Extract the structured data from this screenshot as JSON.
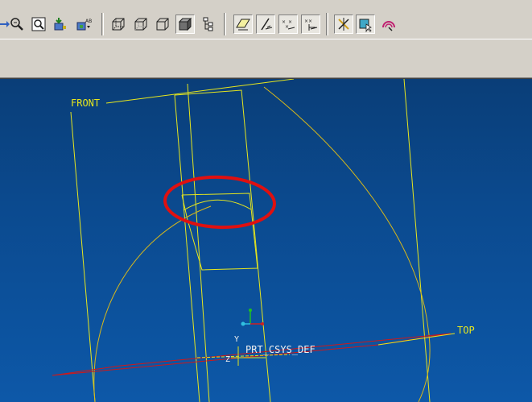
{
  "toolbar": {
    "buttons": [
      {
        "name": "orient-icon"
      },
      {
        "name": "zoom-in-icon"
      },
      {
        "name": "zoom-to-fit-icon"
      },
      {
        "name": "repaint-icon"
      },
      {
        "name": "saved-views-icon"
      },
      {
        "name": "wireframe-icon"
      },
      {
        "name": "hidden-line-icon"
      },
      {
        "name": "no-hidden-icon"
      },
      {
        "name": "shading-icon"
      },
      {
        "name": "model-tree-icon"
      },
      {
        "name": "datum-planes-icon"
      },
      {
        "name": "datum-axes-icon"
      },
      {
        "name": "datum-points-icon"
      },
      {
        "name": "coordinate-systems-icon"
      },
      {
        "name": "spin-center-icon"
      },
      {
        "name": "select-icon"
      },
      {
        "name": "annotation-icon"
      }
    ]
  },
  "viewport": {
    "background": "#0b4a8f",
    "datum_color": "#e6e61e",
    "top_plane_color": "#d01818",
    "highlight_color": "#e01010",
    "labels": {
      "front": "FRONT",
      "top": "TOP",
      "csys": "PRT_CSYS_DEF",
      "axis_y": "Y",
      "axis_z": "Z"
    }
  }
}
